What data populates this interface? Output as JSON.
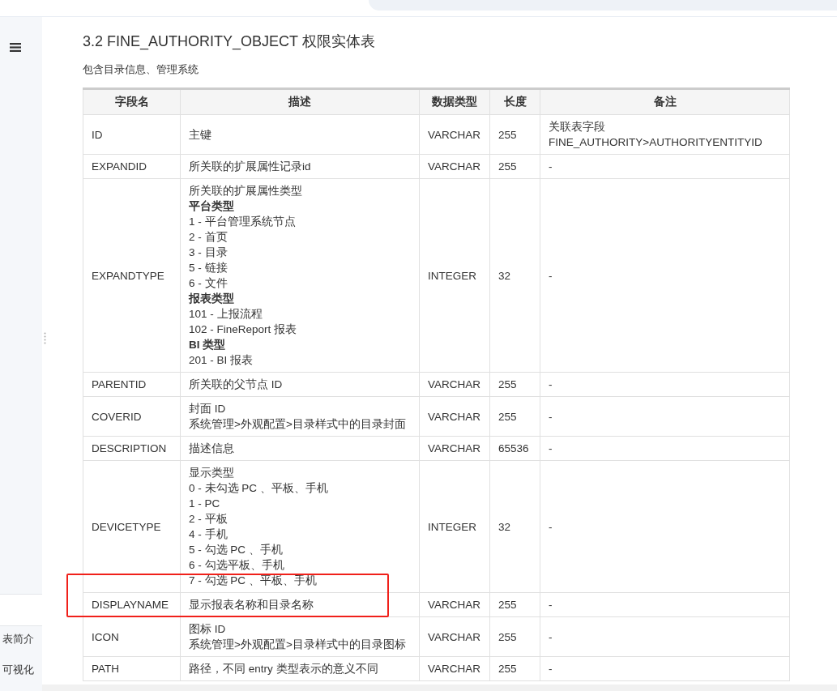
{
  "sidebar": {
    "items": [
      {
        "label": "表简介",
        "selected": false
      },
      {
        "label": "可视化",
        "selected": false
      }
    ]
  },
  "section": {
    "title": "3.2 FINE_AUTHORITY_OBJECT  权限实体表",
    "subtitle": "包含目录信息、管理系统"
  },
  "table": {
    "columns": [
      "字段名",
      "描述",
      "数据类型",
      "长度",
      "备注"
    ],
    "rows": [
      {
        "cells": [
          "ID",
          "主键",
          "VARCHAR",
          "255",
          [
            "关联表字段",
            "FINE_AUTHORITY>AUTHORITYENTITYID"
          ]
        ],
        "highlighted": false
      },
      {
        "cells": [
          "EXPANDID",
          "所关联的扩展属性记录id",
          "VARCHAR",
          "255",
          "-"
        ],
        "highlighted": false
      },
      {
        "cells": [
          "EXPANDTYPE",
          [
            "所关联的扩展属性类型",
            "**平台类型**",
            "1 - 平台管理系统节点",
            "2 - 首页",
            "3 - 目录",
            "5 - 链接",
            "6 - 文件",
            "**报表类型**",
            "101 - 上报流程",
            "102 - FineReport 报表",
            "**BI 类型**",
            "201 - BI 报表"
          ],
          "INTEGER",
          "32",
          "-"
        ],
        "highlighted": false
      },
      {
        "cells": [
          "PARENTID",
          "所关联的父节点 ID",
          "VARCHAR",
          "255",
          "-"
        ],
        "highlighted": false
      },
      {
        "cells": [
          "COVERID",
          [
            "封面 ID",
            "系统管理>外观配置>目录样式中的目录封面"
          ],
          "VARCHAR",
          "255",
          "-"
        ],
        "highlighted": false
      },
      {
        "cells": [
          "DESCRIPTION",
          "描述信息",
          "VARCHAR",
          "65536",
          "-"
        ],
        "highlighted": false
      },
      {
        "cells": [
          "DEVICETYPE",
          [
            "显示类型",
            "0 - 未勾选 PC 、平板、手机",
            "1 - PC",
            "2 - 平板",
            "4 - 手机",
            "5 - 勾选 PC 、手机",
            "6 - 勾选平板、手机",
            "7 - 勾选 PC 、平板、手机"
          ],
          "INTEGER",
          "32",
          "-"
        ],
        "highlighted": false
      },
      {
        "cells": [
          "DISPLAYNAME",
          "显示报表名称和目录名称",
          "VARCHAR",
          "255",
          "-"
        ],
        "highlighted": true
      },
      {
        "cells": [
          "ICON",
          [
            "图标 ID",
            "系统管理>外观配置>目录样式中的目录图标"
          ],
          "VARCHAR",
          "255",
          "-"
        ],
        "highlighted": false
      },
      {
        "cells": [
          "PATH",
          "路径，不同 entry 类型表示的意义不同",
          "VARCHAR",
          "255",
          "-"
        ],
        "highlighted": false
      }
    ]
  }
}
